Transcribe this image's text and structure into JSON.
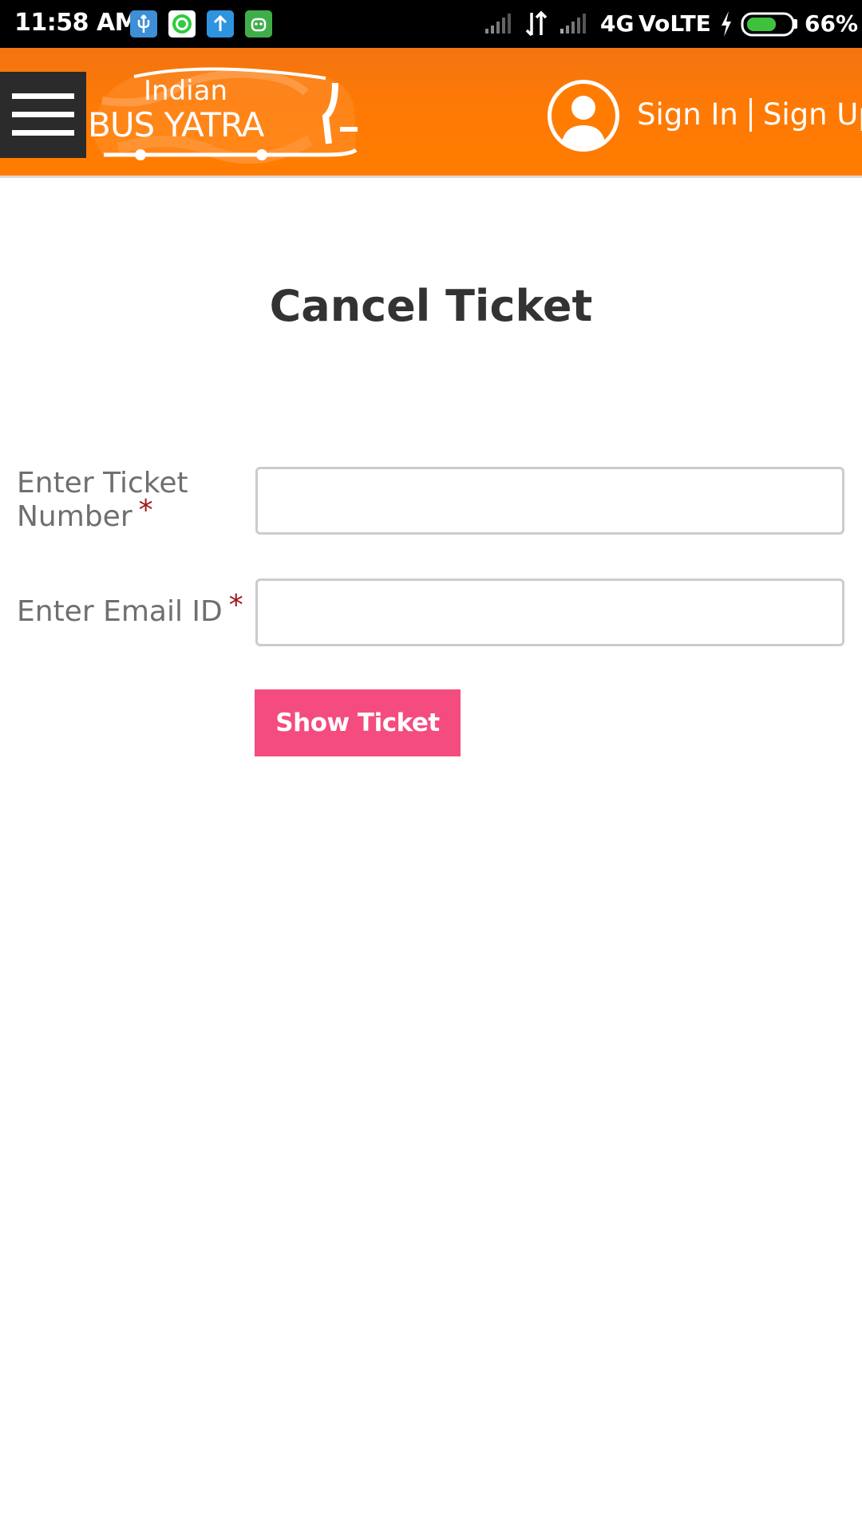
{
  "status_bar": {
    "time": "11:58 AM",
    "network": "4G",
    "volte": "VoLTE",
    "battery": "66%",
    "battery_level": 0.66,
    "notification_icons": [
      "usb-icon",
      "whatsapp-icon",
      "upload-icon",
      "android-icon"
    ]
  },
  "header": {
    "logo_line1": "Indian",
    "logo_line2": "BUS YATRA",
    "sign_in": "Sign In",
    "sign_up": "Sign Up",
    "background_color": "#ff7c00"
  },
  "main": {
    "title": "Cancel Ticket",
    "ticket_label_line1": "Enter Ticket",
    "ticket_label_line2": "Number",
    "ticket_value": "",
    "email_label": "Enter Email ID",
    "email_value": "",
    "required_marker": "*",
    "show_ticket_button": "Show Ticket",
    "button_color": "#f44c7f"
  }
}
